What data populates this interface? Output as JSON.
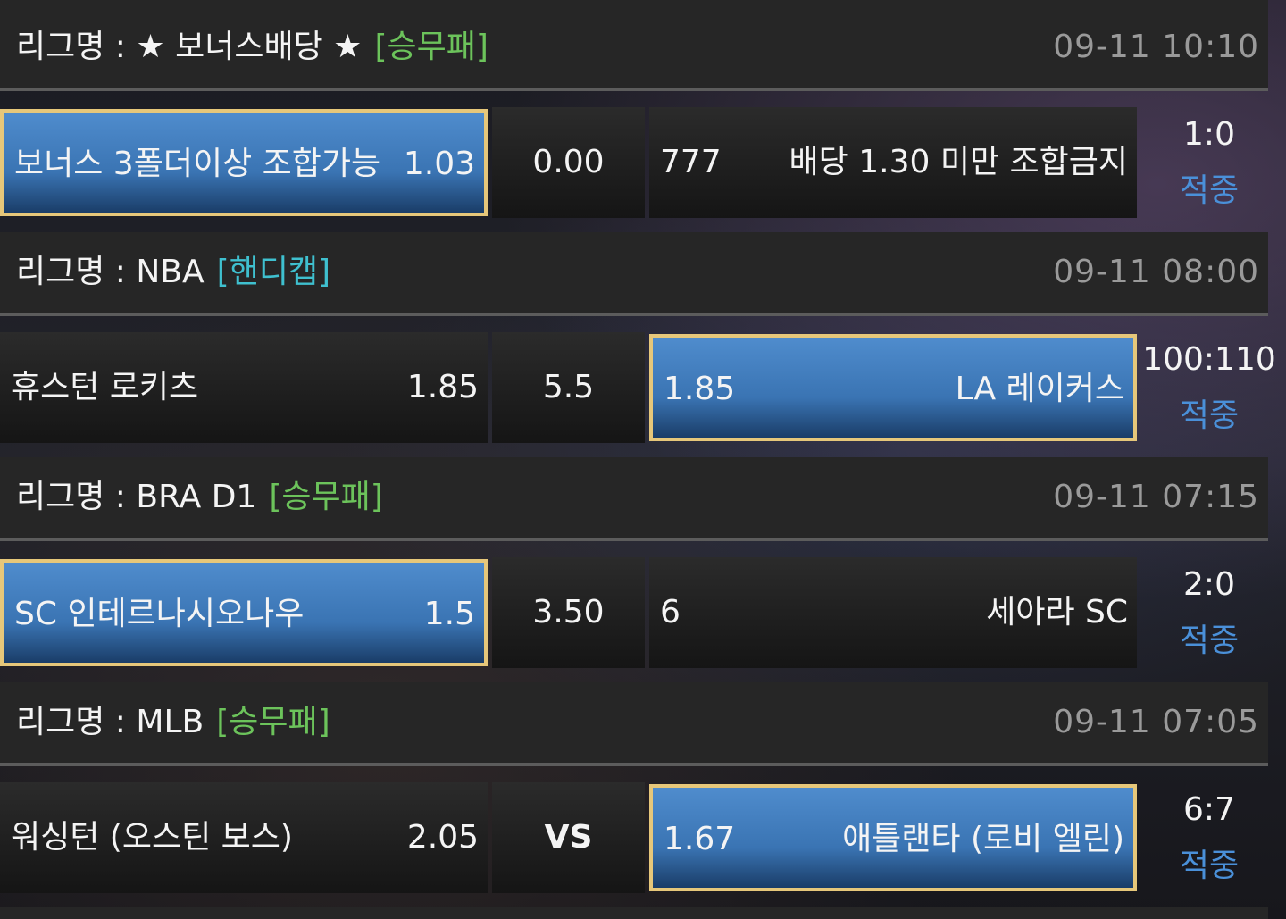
{
  "league_prefix": "리그명 : ",
  "matches": [
    {
      "league": "★ 보너스배당 ★",
      "bet_type": "[승무패]",
      "bet_type_color": "#6cc35b",
      "time": "09-11 10:10",
      "home": {
        "name": "보너스 3폴더이상 조합가능",
        "odds": "1.03",
        "selected": true
      },
      "middle": "0.00",
      "away": {
        "name": "배당 1.30 미만 조합금지",
        "odds": "777",
        "selected": false
      },
      "score": "1:0",
      "status": "적중"
    },
    {
      "league": "NBA",
      "bet_type": "[핸디캡]",
      "bet_type_color": "#3fc0cf",
      "time": "09-11 08:00",
      "home": {
        "name": "휴스턴 로키츠",
        "odds": "1.85",
        "selected": false
      },
      "middle": "5.5",
      "away": {
        "name": "LA 레이커스",
        "odds": "1.85",
        "selected": true
      },
      "score": "100:110",
      "status": "적중"
    },
    {
      "league": "BRA D1",
      "bet_type": "[승무패]",
      "bet_type_color": "#6cc35b",
      "time": "09-11 07:15",
      "home": {
        "name": "SC 인테르나시오나우",
        "odds": "1.5",
        "selected": true
      },
      "middle": "3.50",
      "away": {
        "name": "세아라 SC",
        "odds": "6",
        "selected": false
      },
      "score": "2:0",
      "status": "적중"
    },
    {
      "league": "MLB",
      "bet_type": "[승무패]",
      "bet_type_color": "#6cc35b",
      "time": "09-11 07:05",
      "home": {
        "name": "워싱턴 (오스틴 보스)",
        "odds": "2.05",
        "selected": false
      },
      "middle": "VS",
      "away": {
        "name": "애틀랜타 (로비 엘린)",
        "odds": "1.67",
        "selected": true
      },
      "score": "6:7",
      "status": "적중"
    }
  ]
}
